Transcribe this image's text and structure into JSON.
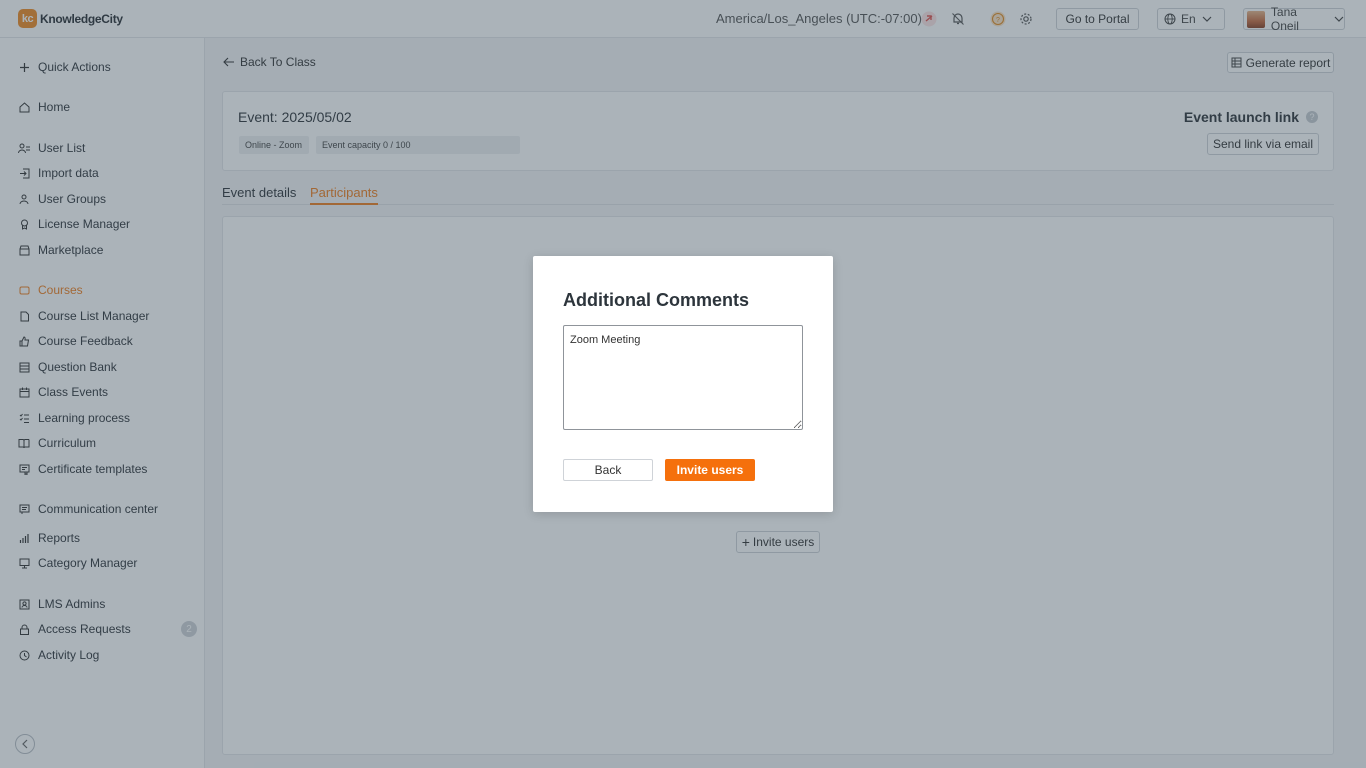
{
  "header": {
    "logo_mark": "kc",
    "logo_text": "KnowledgeCity",
    "timezone": "America/Los_Angeles (UTC:-07:00)",
    "portal_button": "Go to Portal",
    "language": "En",
    "user_name": "Tana Oneil"
  },
  "sidebar": {
    "items": [
      {
        "label": "Quick Actions",
        "icon": "plus-icon"
      },
      {
        "label": "Home",
        "icon": "home-icon"
      },
      {
        "label": "User List",
        "icon": "users-list-icon"
      },
      {
        "label": "Import data",
        "icon": "import-icon"
      },
      {
        "label": "User Groups",
        "icon": "group-icon"
      },
      {
        "label": "License Manager",
        "icon": "license-icon"
      },
      {
        "label": "Marketplace",
        "icon": "store-icon"
      },
      {
        "label": "Courses",
        "icon": "courses-icon"
      },
      {
        "label": "Course List Manager",
        "icon": "file-icon"
      },
      {
        "label": "Course Feedback",
        "icon": "thumbs-up-icon"
      },
      {
        "label": "Question Bank",
        "icon": "database-icon"
      },
      {
        "label": "Class Events",
        "icon": "calendar-icon"
      },
      {
        "label": "Learning process",
        "icon": "checklist-icon"
      },
      {
        "label": "Curriculum",
        "icon": "book-icon"
      },
      {
        "label": "Certificate templates",
        "icon": "certificate-icon"
      },
      {
        "label": "Communication center",
        "icon": "message-icon"
      },
      {
        "label": "Reports",
        "icon": "bar-chart-icon"
      },
      {
        "label": "Category Manager",
        "icon": "monitor-icon"
      },
      {
        "label": "LMS Admins",
        "icon": "admin-icon"
      },
      {
        "label": "Access Requests",
        "icon": "lock-icon",
        "badge": "2"
      },
      {
        "label": "Activity Log",
        "icon": "clock-icon"
      }
    ]
  },
  "main": {
    "back_link": "Back To Class",
    "generate_report": "Generate report",
    "event_title": "Event: 2025/05/02",
    "chip_location": "Online - Zoom",
    "chip_capacity": "Event capacity 0 / 100",
    "launch_link_title": "Event launch link",
    "send_link": "Send link via email",
    "tabs": [
      {
        "label": "Event details"
      },
      {
        "label": "Participants"
      }
    ],
    "invite_users": "Invite users"
  },
  "modal": {
    "title": "Additional Comments",
    "comment_value": "Zoom Meeting",
    "back_button": "Back",
    "invite_button": "Invite users"
  },
  "colors": {
    "accent": "#f07e1e",
    "primary_button": "#f5700c"
  }
}
